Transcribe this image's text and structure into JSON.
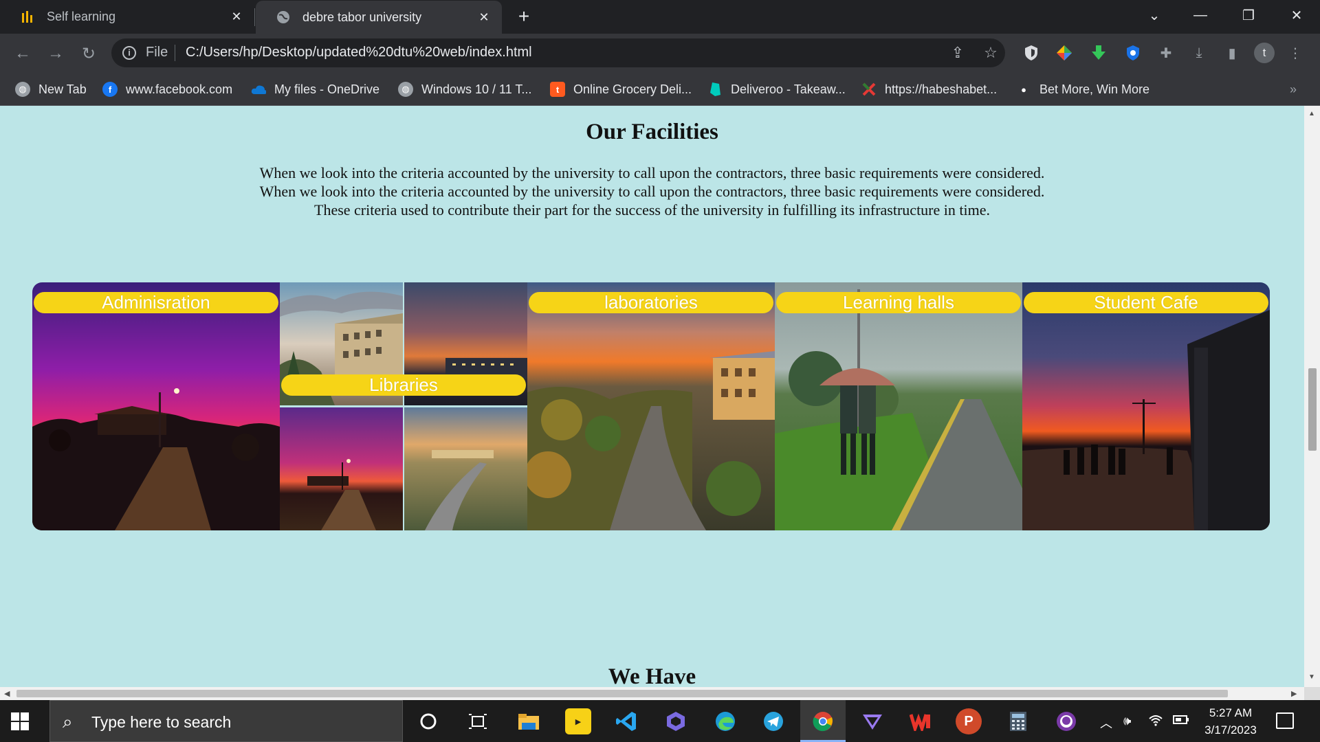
{
  "browser": {
    "tabs": [
      {
        "title": "Self learning",
        "icon": "lines-favicon-icon"
      },
      {
        "title": "debre tabor university",
        "icon": "globe-icon",
        "active": true
      }
    ],
    "omnibox": {
      "scheme_label": "File",
      "url": "C:/Users/hp/Desktop/updated%20dtu%20web/index.html"
    },
    "bookmarks": [
      {
        "label": "New Tab",
        "icon": "globe-icon",
        "color": "#9aa0a6"
      },
      {
        "label": "www.facebook.com",
        "icon": "facebook-icon",
        "color": "#1877f2"
      },
      {
        "label": "My files - OneDrive",
        "icon": "onedrive-cloud-icon",
        "color": "#0f78d4"
      },
      {
        "label": "Windows 10 / 11 T...",
        "icon": "globe-icon",
        "color": "#9aa0a6"
      },
      {
        "label": "Online Grocery Deli...",
        "icon": "t-logo-icon",
        "color": "#ff5a1f"
      },
      {
        "label": "Deliveroo - Takeaw...",
        "icon": "kangaroo-icon",
        "color": "#00ccbc"
      },
      {
        "label": "https://habeshabet...",
        "icon": "x-logo-icon",
        "color": "#e53935"
      },
      {
        "label": "Bet More, Win More",
        "icon": "ball-icon",
        "color": "#ffffff"
      }
    ]
  },
  "page": {
    "title": "Our Facilities",
    "intro_lines": [
      "When we look into the criteria accounted by the university to call upon the contractors, three basic requirements were considered.",
      "When we look into the criteria accounted by the university to call upon the contractors, three basic requirements were considered.",
      "These criteria used to contribute their part for the success of the university in fulfilling its infrastructure in time."
    ],
    "facilities": [
      {
        "label": "Adminisration"
      },
      {
        "label": "Libraries"
      },
      {
        "label": "laboratories"
      },
      {
        "label": "Learning halls"
      },
      {
        "label": "Student Cafe"
      }
    ],
    "next_heading": "We Have"
  },
  "taskbar": {
    "search_placeholder": "Type here to search",
    "time": "5:27 AM",
    "date": "3/17/2023"
  },
  "colors": {
    "page_background": "#bce5e7",
    "label_background": "#f6d417"
  }
}
